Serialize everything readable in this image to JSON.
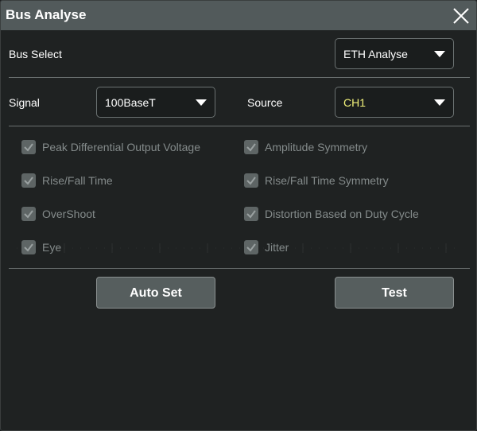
{
  "window": {
    "title": "Bus Analyse",
    "close_icon": "close-icon"
  },
  "bus_select": {
    "label": "Bus Select",
    "value": "ETH Analyse"
  },
  "signal": {
    "label": "Signal",
    "value": "100BaseT"
  },
  "source": {
    "label": "Source",
    "value": "CH1",
    "value_color": "#f2f27a"
  },
  "tests": [
    {
      "label": "Peak Differential Output Voltage",
      "checked": true,
      "enabled": false
    },
    {
      "label": "Amplitude Symmetry",
      "checked": true,
      "enabled": false
    },
    {
      "label": "Rise/Fall Time",
      "checked": true,
      "enabled": false
    },
    {
      "label": "Rise/Fall Time Symmetry",
      "checked": true,
      "enabled": false
    },
    {
      "label": "OverShoot",
      "checked": true,
      "enabled": false
    },
    {
      "label": "Distortion Based on Duty Cycle",
      "checked": true,
      "enabled": false
    },
    {
      "label": "Eye",
      "checked": true,
      "enabled": false
    },
    {
      "label": "Jitter",
      "checked": true,
      "enabled": false
    }
  ],
  "buttons": {
    "auto_set": "Auto Set",
    "test": "Test"
  },
  "colors": {
    "title_bar": "#525a5b",
    "background": "#1f2222",
    "disabled_text": "#848b8b"
  }
}
